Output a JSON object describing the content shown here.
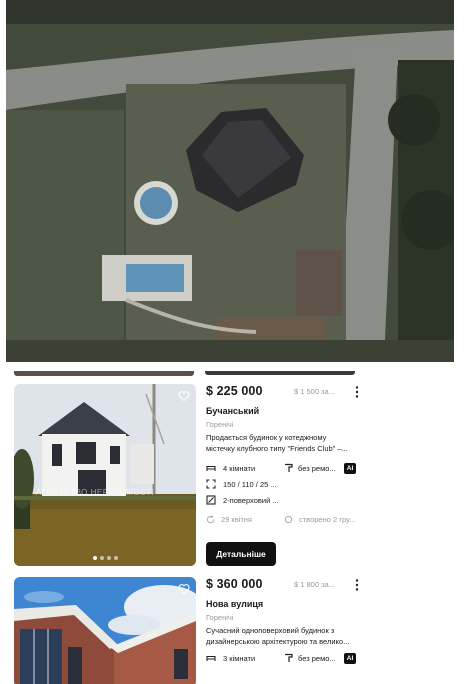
{
  "aerial_image": {
    "alt_icon": "satellite-photo"
  },
  "listings": [
    {
      "price": "$ 225 000",
      "price_per_sqm": "$ 1 500 за...",
      "street": "Бучанський",
      "locality": "Горенічі",
      "description": "Продається будинок у котеджному містечку клубного типу \"Friends Club\" –...",
      "rooms": "4 кімнати",
      "renovation": "без ремо...",
      "area": "150 / 110 / 25 ...",
      "floors": "2-поверховий ...",
      "date": "29 квітня",
      "group": "створено 2 гру...",
      "ai_badge": "AI",
      "watermark": "АГЕНТСТВО НЕРУХОМОСТІ",
      "details_label": "Детальніше"
    },
    {
      "price": "$ 360 000",
      "price_per_sqm": "$ 1 800 за...",
      "street": "Нова вулиця",
      "locality": "Горенічі",
      "description": "Сучасний одноповерховий будинок з дизайнерською архітектурою та велико...",
      "rooms": "3 кімнати",
      "renovation": "без ремо...",
      "ai_badge": "AI"
    }
  ],
  "colors": {
    "button_bg": "#111111",
    "muted_text": "#9a9a9a"
  }
}
